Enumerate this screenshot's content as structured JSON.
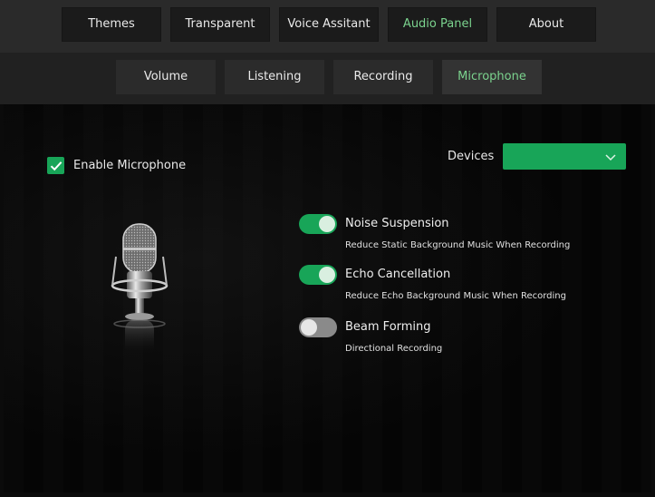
{
  "nav": {
    "tabs": [
      {
        "label": "Themes",
        "active": false
      },
      {
        "label": "Transparent",
        "active": false
      },
      {
        "label": "Voice Assitant",
        "active": false
      },
      {
        "label": "Audio Panel",
        "active": true
      },
      {
        "label": "About",
        "active": false
      }
    ]
  },
  "subnav": {
    "tabs": [
      {
        "label": "Volume",
        "active": false
      },
      {
        "label": "Listening",
        "active": false
      },
      {
        "label": "Recording",
        "active": false
      },
      {
        "label": "Microphone",
        "active": true
      }
    ]
  },
  "microphone": {
    "enable_label": "Enable Microphone",
    "enable_checked": true,
    "devices_label": "Devices",
    "devices_value": ""
  },
  "settings": [
    {
      "title": "Noise Suspension",
      "description": "Reduce Static Background Music When Recording",
      "enabled": true
    },
    {
      "title": "Echo Cancellation",
      "description": "Reduce Echo Background Music When Recording",
      "enabled": true
    },
    {
      "title": "Beam Forming",
      "description": "Directional Recording",
      "enabled": false
    }
  ],
  "colors": {
    "accent": "#18a558",
    "active_text": "#7bd38e"
  }
}
